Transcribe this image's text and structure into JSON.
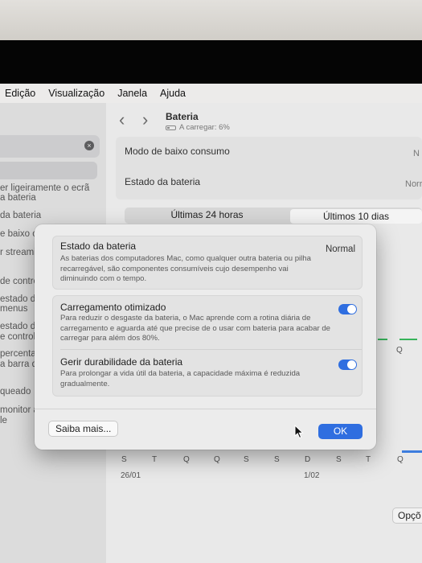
{
  "menubar": {
    "items": [
      "Edição",
      "Visualização",
      "Janela",
      "Ajuda"
    ]
  },
  "sidebar": {
    "clear_glyph": "×",
    "fragments": [
      "er ligeiramente o ecrã",
      "a bateria",
      "da bateria",
      "e baixo co",
      "r streamin",
      "de contro",
      "estado da",
      "menus",
      "estado di",
      "e control",
      "percenta",
      "a barra d",
      "queado",
      "monitor a",
      "le"
    ]
  },
  "window": {
    "back_glyph": "‹",
    "forward_glyph": "›",
    "title": "Bateria",
    "subtitle": "A carregar: 6%",
    "rows": [
      {
        "label": "Modo de baixo consumo",
        "value": "N"
      },
      {
        "label": "Estado da bateria",
        "value": "Norr"
      }
    ],
    "segments": [
      "Últimas 24 horas",
      "Últimos 10 dias"
    ],
    "chart_day_letters": [
      "S",
      "T",
      "Q",
      "Q",
      "S",
      "S",
      "D",
      "S",
      "T",
      "Q"
    ],
    "chart_dates": [
      "26/01",
      "1/02"
    ],
    "chart_right_letter": "Q",
    "options_label": "Opçõ"
  },
  "modal": {
    "battery_health": {
      "title": "Estado da bateria",
      "value": "Normal",
      "description": "As baterias dos computadores Mac, como qualquer outra bateria ou pilha recarregável, são componentes consumíveis cujo desempenho vai diminuindo com o tempo."
    },
    "optimized_charging": {
      "title": "Carregamento otimizado",
      "description": "Para reduzir o desgaste da bateria, o Mac aprende com a rotina diária de carregamento e aguarda até que precise de o usar com bateria para acabar de carregar para além dos 80%.",
      "enabled": true
    },
    "manage_longevity": {
      "title": "Gerir durabilidade da bateria",
      "description": "Para prolongar a vida útil da bateria, a capacidade máxima é reduzida gradualmente.",
      "enabled": true
    },
    "learn_more_label": "Saiba mais...",
    "ok_label": "OK"
  },
  "colors": {
    "accent": "#2f6ee0",
    "chart_green": "#36b35a"
  }
}
